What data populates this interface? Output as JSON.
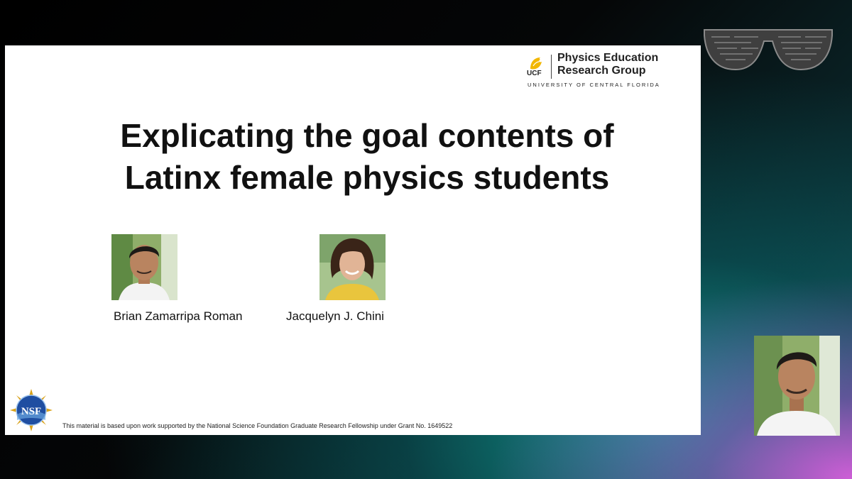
{
  "slide": {
    "logo": {
      "ucf": "UCF",
      "name": "Physics Education\nResearch Group",
      "university": "UNIVERSITY OF CENTRAL FLORIDA"
    },
    "title_line1": "Explicating the goal contents of",
    "title_line2": "Latinx female physics students",
    "authors": [
      {
        "name": "Brian Zamarripa Roman"
      },
      {
        "name": "Jacquelyn J. Chini"
      }
    ],
    "funding_note": "This material is based upon work supported by the National Science Foundation Graduate Research Fellowship under Grant No. 1649522",
    "nsf_logo_text": "NSF"
  },
  "colors": {
    "ucf_gold": "#f2b700",
    "nsf_blue": "#1f4ea1",
    "background_teal": "#14a9a0",
    "background_magenta": "#d85edc"
  },
  "icons": [
    "sunglasses-wordcloud-icon",
    "ucf-pegasus-icon",
    "nsf-seal-icon"
  ]
}
